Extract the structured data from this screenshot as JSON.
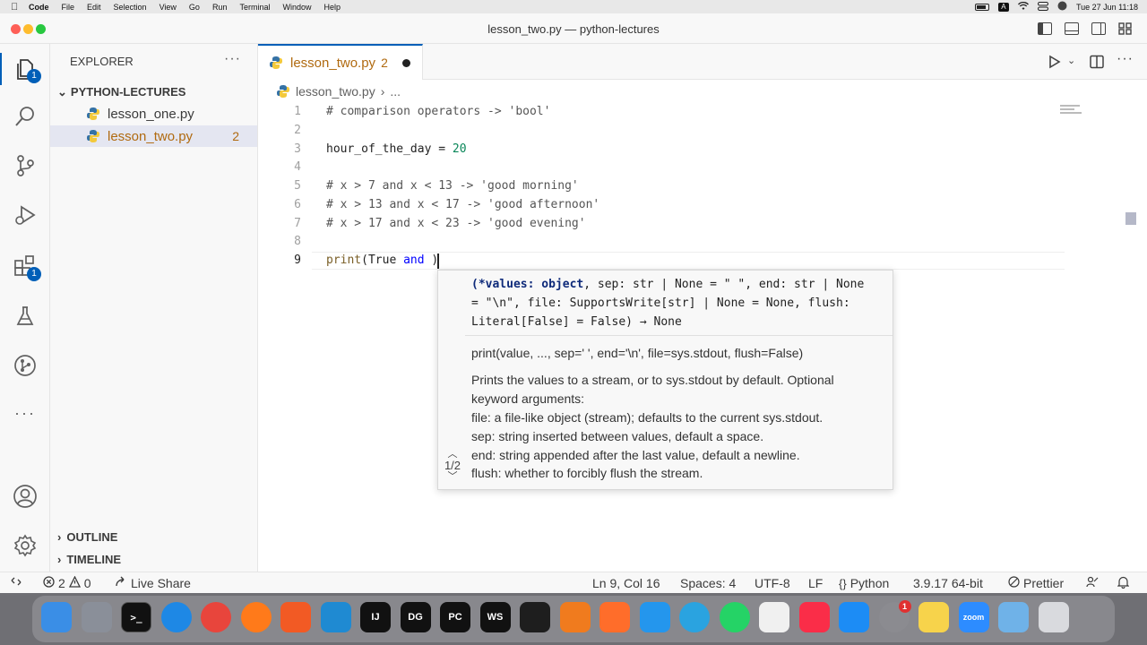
{
  "menubar": {
    "app": "Code",
    "items": [
      "File",
      "Edit",
      "Selection",
      "View",
      "Go",
      "Run",
      "Terminal",
      "Window",
      "Help"
    ],
    "clock": "Tue 27 Jun  11:18",
    "input_source": "A"
  },
  "window": {
    "title": "lesson_two.py — python-lectures"
  },
  "activity": {
    "explorer_badge": "1",
    "extensions_badge": "1"
  },
  "sidebar": {
    "title": "EXPLORER",
    "more": "···",
    "folder": "PYTHON-LECTURES",
    "files": [
      {
        "name": "lesson_one.py",
        "badge": ""
      },
      {
        "name": "lesson_two.py",
        "badge": "2"
      }
    ],
    "outline": "OUTLINE",
    "timeline": "TIMELINE"
  },
  "editor": {
    "tab": {
      "name": "lesson_two.py",
      "problems": "2"
    },
    "breadcrumb": {
      "file": "lesson_two.py",
      "more": "..."
    },
    "lines": [
      {
        "n": "1",
        "text": "# comparison operators -> 'bool'"
      },
      {
        "n": "2",
        "text": ""
      },
      {
        "n": "3",
        "text": "hour_of_the_day = 20"
      },
      {
        "n": "4",
        "text": ""
      },
      {
        "n": "5",
        "text": "# x > 7 and x < 13 -> 'good morning'"
      },
      {
        "n": "6",
        "text": "# x > 13 and x < 17 -> 'good afternoon'"
      },
      {
        "n": "7",
        "text": "# x > 17 and x < 23 -> 'good evening'"
      },
      {
        "n": "8",
        "text": ""
      },
      {
        "n": "9",
        "text": "print(True and )"
      }
    ]
  },
  "hover": {
    "signature": [
      "(*values: object, sep: str | None = \" \", end: str | None",
      "= \"\\n\", file: SupportsWrite[str] | None = None, flush:",
      "Literal[False] = False) → None"
    ],
    "doc": [
      "print(value, ..., sep=' ', end='\\n', file=sys.stdout, flush=False)",
      "Prints the values to a stream, or to sys.stdout by default. Optional",
      "keyword arguments:",
      "file: a file-like object (stream); defaults to the current sys.stdout.",
      "sep: string inserted between values, default a space.",
      "end: string appended after the last value, default a newline.",
      "flush: whether to forcibly flush the stream."
    ],
    "pager": "1/2"
  },
  "status": {
    "errors": "2",
    "warnings": "0",
    "live_share": "Live Share",
    "position": "Ln 9, Col 16",
    "spaces": "Spaces: 4",
    "encoding": "UTF-8",
    "eol": "LF",
    "language": "Python",
    "interpreter": "3.9.17 64-bit",
    "formatter": "Prettier"
  },
  "dock": {
    "apps": [
      {
        "name": "Finder",
        "icon": "finder-icon",
        "color": "#3a8ee6"
      },
      {
        "name": "Launchpad",
        "icon": "launchpad-icon",
        "color": "#8a8f99"
      },
      {
        "name": "Terminal",
        "icon": "terminal-icon",
        "color": "#111111"
      },
      {
        "name": "Safari",
        "icon": "safari-icon",
        "color": "#1e88e5"
      },
      {
        "name": "Chrome",
        "icon": "chrome-icon",
        "color": "#e8453c"
      },
      {
        "name": "Firefox",
        "icon": "firefox-icon",
        "color": "#ff7a1a"
      },
      {
        "name": "Brave",
        "icon": "brave-icon",
        "color": "#f25a24"
      },
      {
        "name": "VS Code",
        "icon": "vscode-icon",
        "color": "#1f8ad2"
      },
      {
        "name": "IntelliJ",
        "icon": "intellij-icon",
        "color": "#111111"
      },
      {
        "name": "DataGrip",
        "icon": "datagrip-icon",
        "color": "#111111"
      },
      {
        "name": "PyCharm",
        "icon": "pycharm-icon",
        "color": "#111111"
      },
      {
        "name": "WebStorm",
        "icon": "webstorm-icon",
        "color": "#111111"
      },
      {
        "name": "Figma",
        "icon": "figma-icon",
        "color": "#1e1e1e"
      },
      {
        "name": "Git",
        "icon": "git-icon",
        "color": "#f07b1e"
      },
      {
        "name": "Pen",
        "icon": "pen-icon",
        "color": "#ff6d2a"
      },
      {
        "name": "Docker",
        "icon": "docker-icon",
        "color": "#2496ed"
      },
      {
        "name": "Telegram",
        "icon": "telegram-icon",
        "color": "#2aa3e0"
      },
      {
        "name": "WhatsApp",
        "icon": "whatsapp-icon",
        "color": "#25d366"
      },
      {
        "name": "Photos",
        "icon": "photos-icon",
        "color": "#f0f0f0"
      },
      {
        "name": "Music",
        "icon": "music-icon",
        "color": "#fa2d48"
      },
      {
        "name": "App Store",
        "icon": "appstore-icon",
        "color": "#1c8cf5"
      },
      {
        "name": "Settings",
        "icon": "settings-icon",
        "color": "#8b8b90"
      },
      {
        "name": "Notes",
        "icon": "notes-icon",
        "color": "#f7d34b"
      },
      {
        "name": "Zoom",
        "icon": "zoom-icon",
        "color": "#2d8cff"
      },
      {
        "name": "Downloads",
        "icon": "downloads-folder-icon",
        "color": "#6fb2e8"
      },
      {
        "name": "Trash",
        "icon": "trash-icon",
        "color": "#d9dade"
      }
    ],
    "labels": {
      "intellij": "IJ",
      "datagrip": "DG",
      "pycharm": "PC",
      "webstorm": "WS",
      "zoom": "zoom",
      "settings_badge": "1"
    }
  }
}
